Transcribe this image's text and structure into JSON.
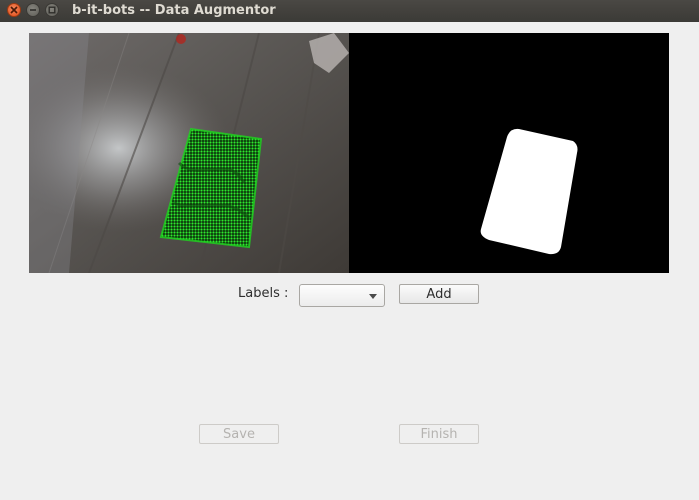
{
  "window": {
    "title": "b-it-bots -- Data Augmentor"
  },
  "controls": {
    "labels_text": "Labels :",
    "labels_combo_value": "",
    "add_label": "Add",
    "save_label": "Save",
    "finish_label": "Finish",
    "save_enabled": false,
    "finish_enabled": false
  },
  "images": {
    "left": "camera-view-with-object-highlight",
    "right": "binary-object-mask"
  },
  "icons": [
    "close-icon",
    "minimize-icon",
    "maximize-icon",
    "chevron-down-icon"
  ],
  "colors": {
    "highlight": "#22e022",
    "mask": "#ffffff",
    "mask_background": "#000000"
  }
}
